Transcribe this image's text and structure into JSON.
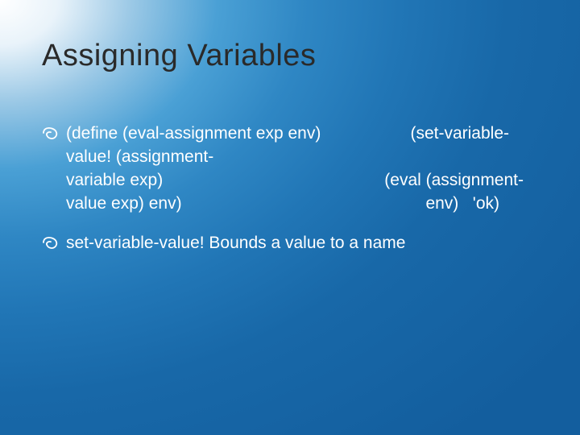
{
  "title": "Assigning Variables",
  "bullets": [
    {
      "code": {
        "l1_left": "(define (eval-assignment exp env)",
        "l1_right": "(set-variable-",
        "l2_left": "value! (assignment-",
        "l3_left": "variable exp)",
        "l3_right": "(eval (assignment-",
        "l4_left": "value exp) env)",
        "l4_right": "env)   'ok)"
      }
    },
    {
      "text": "set-variable-value! Bounds a value to a name"
    }
  ]
}
